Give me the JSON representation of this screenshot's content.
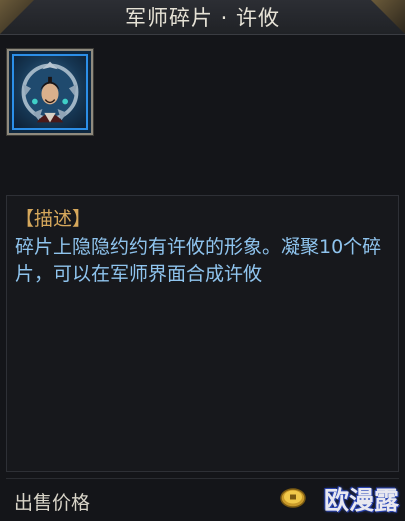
{
  "window": {
    "title": "军师碎片 · 许攸"
  },
  "item": {
    "icon_name": "xu-you-portrait-icon"
  },
  "description": {
    "heading": "【描述】",
    "body": "碎片上隐隐约约有许攸的形象。凝聚10个碎片，可以在军师界面合成许攸"
  },
  "price": {
    "label": "出售价格",
    "currency_icon": "gold-coin-icon"
  },
  "watermark": {
    "text": "欧漫露"
  },
  "colors": {
    "description_text": "#8fc4ee",
    "heading_text": "#d6a85c",
    "frame_accent": "#2c8fe8"
  }
}
